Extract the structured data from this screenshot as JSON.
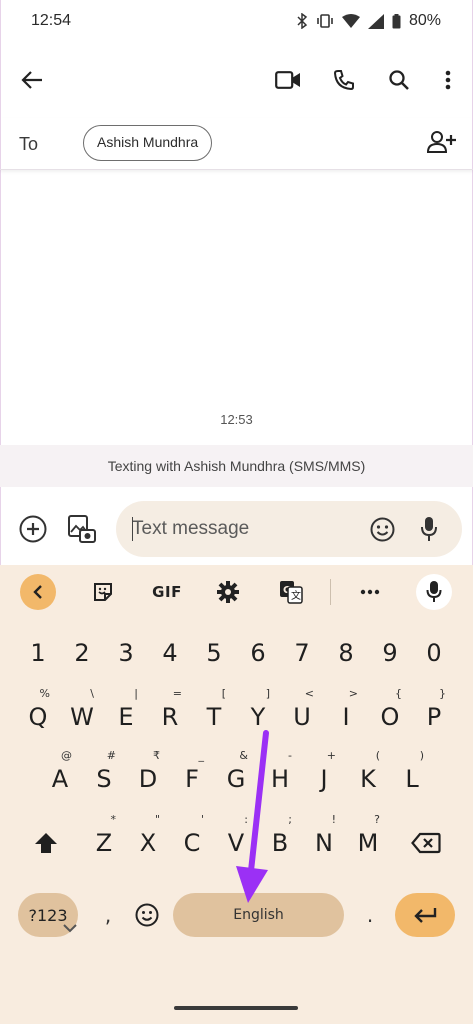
{
  "status_bar": {
    "time": "12:54",
    "battery": "80%"
  },
  "conversation": {
    "to_label": "To",
    "recipient": "Ashish Mundhra",
    "timestamp": "12:53",
    "texting_info": "Texting with Ashish Mundhra (SMS/MMS)"
  },
  "compose": {
    "placeholder": "Text message"
  },
  "keyboard": {
    "toolbar": {
      "gif_label": "GIF"
    },
    "number_row": [
      "1",
      "2",
      "3",
      "4",
      "5",
      "6",
      "7",
      "8",
      "9",
      "0"
    ],
    "row1": [
      {
        "key": "Q",
        "hint": "%"
      },
      {
        "key": "W",
        "hint": "\\"
      },
      {
        "key": "E",
        "hint": "|"
      },
      {
        "key": "R",
        "hint": "="
      },
      {
        "key": "T",
        "hint": "["
      },
      {
        "key": "Y",
        "hint": "]"
      },
      {
        "key": "U",
        "hint": "<"
      },
      {
        "key": "I",
        "hint": ">"
      },
      {
        "key": "O",
        "hint": "{"
      },
      {
        "key": "P",
        "hint": "}"
      }
    ],
    "row2": [
      {
        "key": "A",
        "hint": "@"
      },
      {
        "key": "S",
        "hint": "#"
      },
      {
        "key": "D",
        "hint": "₹"
      },
      {
        "key": "F",
        "hint": "_"
      },
      {
        "key": "G",
        "hint": "&"
      },
      {
        "key": "H",
        "hint": "-"
      },
      {
        "key": "J",
        "hint": "+"
      },
      {
        "key": "K",
        "hint": "("
      },
      {
        "key": "L",
        "hint": ")"
      }
    ],
    "row3": [
      {
        "key": "Z",
        "hint": "*"
      },
      {
        "key": "X",
        "hint": "\""
      },
      {
        "key": "C",
        "hint": "'"
      },
      {
        "key": "V",
        "hint": ":"
      },
      {
        "key": "B",
        "hint": ";"
      },
      {
        "key": "N",
        "hint": "!"
      },
      {
        "key": "M",
        "hint": "?"
      }
    ],
    "symbols_label": "?123",
    "comma": ",",
    "space_label": "English",
    "period": "."
  },
  "colors": {
    "keyboard_bg": "#f8ecdf",
    "accent_key": "#f2b86a",
    "pill_key": "#e0c29e",
    "annotation_arrow": "#9b30f5"
  }
}
